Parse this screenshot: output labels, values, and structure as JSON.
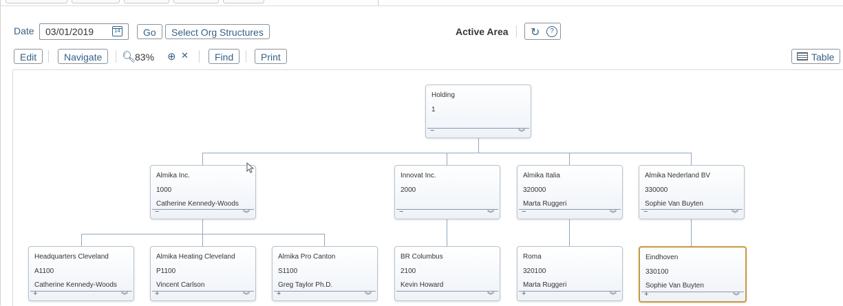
{
  "toolbar": {
    "date_label": "Date",
    "date_value": "03/01/2019",
    "calendar_icon": "14",
    "go": "Go",
    "select_org": "Select Org Structures",
    "active_area": "Active Area",
    "edit": "Edit",
    "navigate": "Navigate",
    "zoom": "83%",
    "find": "Find",
    "print": "Print",
    "table": "Table"
  },
  "icons": {
    "calendar": "calendar-icon",
    "refresh": "refresh-icon",
    "help": "help-icon",
    "zoom_out": "zoom-out-icon",
    "zoom_in": "zoom-in-icon",
    "fit": "fit-to-screen-icon",
    "table": "table-icon"
  },
  "nodes": {
    "holding": {
      "name": "Holding",
      "code": "1",
      "manager": "",
      "toggle": "−"
    },
    "almika_inc": {
      "name": "Almika Inc.",
      "code": "1000",
      "manager": "Catherine Kennedy-Woods",
      "toggle": "−"
    },
    "innovat": {
      "name": "Innovat Inc.",
      "code": "2000",
      "manager": "",
      "toggle": "−"
    },
    "almika_italia": {
      "name": "Almika Italia",
      "code": "320000",
      "manager": "Marta Ruggeri",
      "toggle": "−"
    },
    "almika_nl": {
      "name": "Almika Nederland BV",
      "code": "330000",
      "manager": "Sophie Van Buyten",
      "toggle": "−"
    },
    "hq_cleveland": {
      "name": "Headquarters Cleveland",
      "code": "A1100",
      "manager": "Catherine Kennedy-Woods",
      "toggle": "+"
    },
    "heating_cleveland": {
      "name": "Almika Heating Cleveland",
      "code": "P1100",
      "manager": "Vincent Carlson",
      "toggle": "+"
    },
    "pro_canton": {
      "name": "Almika Pro Canton",
      "code": "S1100",
      "manager": "Greg Taylor Ph.D.",
      "toggle": "+"
    },
    "br_columbus": {
      "name": "BR Columbus",
      "code": "2100",
      "manager": "Kevin Howard",
      "toggle": ""
    },
    "roma": {
      "name": "Roma",
      "code": "320100",
      "manager": "Marta Ruggeri",
      "toggle": "+"
    },
    "eindhoven": {
      "name": "Eindhoven",
      "code": "330100",
      "manager": "Sophie Van Buyten",
      "toggle": "+"
    }
  }
}
